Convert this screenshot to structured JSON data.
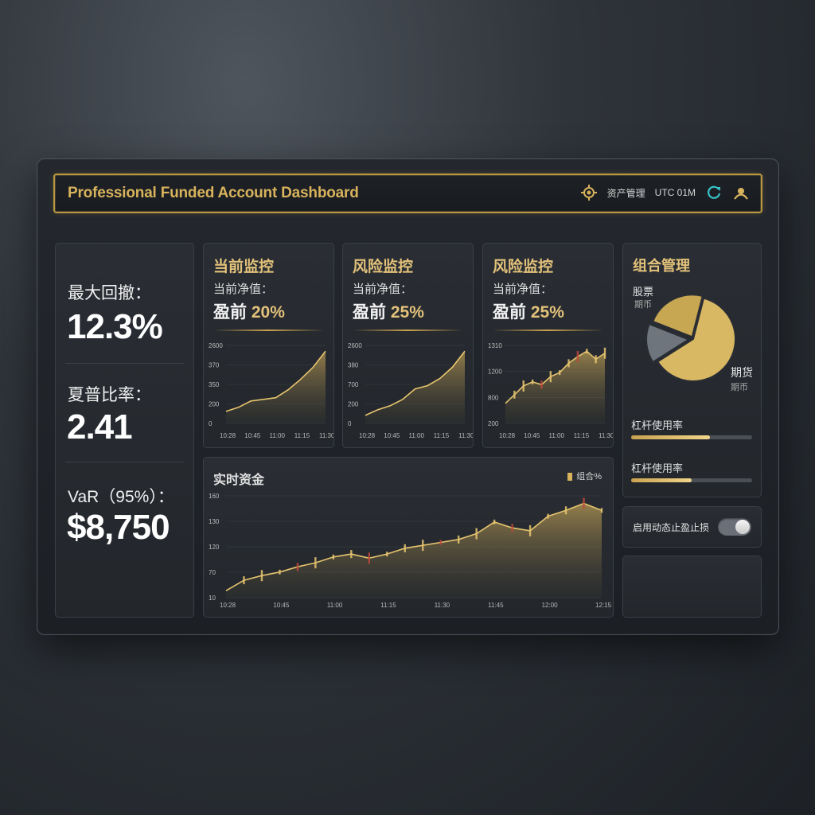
{
  "header": {
    "title": "Professional Funded Account Dashboard",
    "asset_label": "资产管理",
    "time_label": "UTC 01M",
    "icons": [
      "gear-icon",
      "refresh-icon",
      "profile-icon"
    ],
    "accent": "#d8b35c"
  },
  "stats": {
    "drawdown_label": "最大回撤：",
    "drawdown_value": "12.3%",
    "sharpe_label": "夏普比率：",
    "sharpe_value": "2.41",
    "var_label": "VaR（95%）：",
    "var_value": "$8,750"
  },
  "cards": [
    {
      "title": "当前监控",
      "sub": "当前净值：",
      "prefix": "盈前",
      "value": "20%"
    },
    {
      "title": "风险监控",
      "sub": "当前净值：",
      "prefix": "盈前",
      "value": "25%"
    },
    {
      "title": "风险监控",
      "sub": "当前净值：",
      "prefix": "盈前",
      "value": "25%"
    }
  ],
  "chart_data": [
    {
      "type": "area",
      "yticks": [
        "2600",
        "370",
        "350",
        "200",
        "0"
      ],
      "xticks": [
        "10:28",
        "10:45",
        "11:00",
        "11:15",
        "11:30"
      ],
      "values": [
        150,
        200,
        280,
        300,
        320,
        420,
        550,
        700,
        900
      ]
    },
    {
      "type": "area",
      "yticks": [
        "2600",
        "380",
        "700",
        "200",
        "0"
      ],
      "xticks": [
        "10:28",
        "10:45",
        "11:00",
        "11:15",
        "11:30"
      ],
      "values": [
        100,
        170,
        220,
        300,
        430,
        470,
        560,
        700,
        900
      ]
    },
    {
      "type": "line",
      "yticks": [
        "1310",
        "1200",
        "800",
        "200"
      ],
      "xticks": [
        "10:28",
        "10:45",
        "11:00",
        "11:15",
        "11:30"
      ],
      "values": [
        300,
        430,
        560,
        620,
        580,
        700,
        760,
        900,
        1000,
        1080,
        960,
        1050
      ]
    },
    {
      "type": "area",
      "title": "实时资金",
      "legend": "组合%",
      "yticks": [
        "160",
        "130",
        "120",
        "70",
        "10"
      ],
      "xticks": [
        "10:28",
        "10:45",
        "11:00",
        "11:15",
        "11:30",
        "11:45",
        "12:00",
        "12:15"
      ],
      "values": [
        12,
        30,
        38,
        44,
        53,
        60,
        70,
        75,
        68,
        75,
        85,
        90,
        95,
        100,
        110,
        130,
        120,
        115,
        140,
        150,
        162,
        150
      ]
    },
    {
      "type": "pie",
      "title": "组合管理",
      "labels": [
        {
          "name": "股票",
          "sub": "期币"
        },
        {
          "name": "期货",
          "sub": "期币"
        }
      ],
      "values": [
        0.62,
        0.15,
        0.23
      ],
      "colors": [
        "#d9b864",
        "#6f757c",
        "#c8a753"
      ]
    }
  ],
  "portfolio": {
    "title": "组合管理",
    "slice_labels": [
      "股票",
      "期币",
      "期货",
      "期币"
    ],
    "leverage": [
      {
        "label": "杠杆使用率",
        "fraction": 0.65
      },
      {
        "label": "杠杆使用率",
        "fraction": 0.5
      }
    ],
    "toggle_label": "启用动态止盈止损",
    "toggle_on": true
  }
}
